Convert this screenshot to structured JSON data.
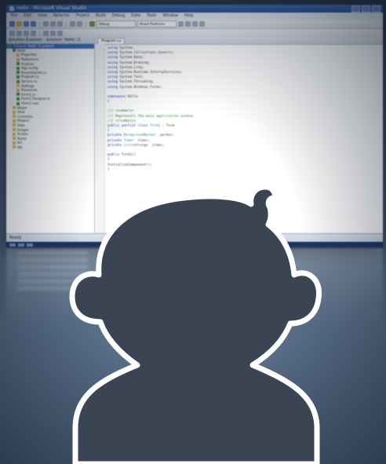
{
  "window": {
    "title": "Hello - Microsoft Visual Studio"
  },
  "menu": [
    "File",
    "Edit",
    "View",
    "Refactor",
    "Project",
    "Build",
    "Debug",
    "Data",
    "Tools",
    "Window",
    "Help"
  ],
  "toolbar": {
    "config_combo": "Debug",
    "platform_combo": "Mixed Platforms"
  },
  "solution_explorer": {
    "header": "Solution Explorer - Solution 'Hello' (1 project)",
    "items": [
      "Solution 'Hello' (1 project)",
      "Hello",
      "Properties",
      "References",
      "Analysis",
      "App.config",
      "AssemblyInfo.cs",
      "Program.cs",
      "Service.cs",
      "Settings",
      "Resources",
      "Form1.cs",
      "Form1.Designer.cs",
      "Form1.resx",
      "Model",
      "View",
      "Controller",
      "Helpers",
      "Data",
      "Images",
      "Scripts",
      "Styles",
      "bin",
      "obj"
    ]
  },
  "editor": {
    "tab": "Program.cs",
    "lines": [
      [
        {
          "c": "kw",
          "t": "using"
        },
        {
          "c": "tx",
          "t": " System;"
        }
      ],
      [
        {
          "c": "kw",
          "t": "using"
        },
        {
          "c": "tx",
          "t": " System.Collections.Generic;"
        }
      ],
      [
        {
          "c": "kw",
          "t": "using"
        },
        {
          "c": "tx",
          "t": " System.Data;"
        }
      ],
      [
        {
          "c": "kw",
          "t": "using"
        },
        {
          "c": "tx",
          "t": " System.Drawing;"
        }
      ],
      [
        {
          "c": "kw",
          "t": "using"
        },
        {
          "c": "tx",
          "t": " System.Linq;"
        }
      ],
      [
        {
          "c": "kw",
          "t": "using"
        },
        {
          "c": "tx",
          "t": " System.Runtime.InteropServices;"
        }
      ],
      [
        {
          "c": "kw",
          "t": "using"
        },
        {
          "c": "tx",
          "t": " System.Text;"
        }
      ],
      [
        {
          "c": "kw",
          "t": "using"
        },
        {
          "c": "tx",
          "t": " System.Threading;"
        }
      ],
      [
        {
          "c": "kw",
          "t": "using"
        },
        {
          "c": "tx",
          "t": " System.Windows.Forms;"
        }
      ],
      [
        {
          "c": "tx",
          "t": ""
        }
      ],
      [
        {
          "c": "kw",
          "t": "namespace"
        },
        {
          "c": "tx",
          "t": " Hello"
        }
      ],
      [
        {
          "c": "tx",
          "t": "{"
        }
      ],
      [
        {
          "c": "tx",
          "t": ""
        }
      ],
      [
        {
          "c": "cm",
          "t": "    /// <summary>"
        }
      ],
      [
        {
          "c": "cm",
          "t": "    /// Represents the main application window."
        }
      ],
      [
        {
          "c": "cm",
          "t": "    /// </summary>"
        }
      ],
      [
        {
          "c": "kw",
          "t": "    public partial class"
        },
        {
          "c": "ty",
          "t": " Form1"
        },
        {
          "c": "tx",
          "t": " : Form"
        }
      ],
      [
        {
          "c": "tx",
          "t": "    {"
        }
      ],
      [
        {
          "c": "kw",
          "t": "        private"
        },
        {
          "c": "ty",
          "t": " BackgroundWorker"
        },
        {
          "c": "tx",
          "t": " _worker;"
        }
      ],
      [
        {
          "c": "kw",
          "t": "        private"
        },
        {
          "c": "ty",
          "t": " Timer"
        },
        {
          "c": "tx",
          "t": " _timer;"
        }
      ],
      [
        {
          "c": "kw",
          "t": "        private"
        },
        {
          "c": "ty",
          "t": " List"
        },
        {
          "c": "tx",
          "t": "<string> _items;"
        }
      ],
      [
        {
          "c": "tx",
          "t": ""
        }
      ],
      [
        {
          "c": "kw",
          "t": "        public"
        },
        {
          "c": "tx",
          "t": " Form1()"
        }
      ],
      [
        {
          "c": "tx",
          "t": "        {"
        }
      ],
      [
        {
          "c": "tx",
          "t": "            InitializeComponent();"
        }
      ],
      [
        {
          "c": "tx",
          "t": "        }"
        }
      ]
    ]
  },
  "status": {
    "text": "Ready"
  },
  "avatar": {
    "fill": "#3a4452",
    "stroke": "#ffffff"
  }
}
